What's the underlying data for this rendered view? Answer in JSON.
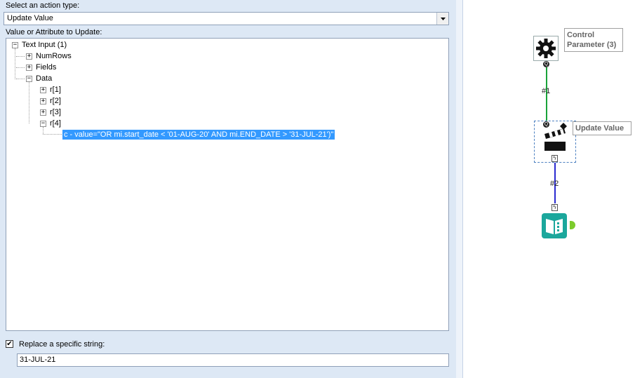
{
  "config": {
    "action_type_label": "Select an action type:",
    "action_type_value": "Update Value",
    "value_attr_label": "Value or Attribute to Update:",
    "tree": {
      "root": "Text Input (1)",
      "numrows": "NumRows",
      "fields": "Fields",
      "data": "Data",
      "r1": "r[1]",
      "r2": "r[2]",
      "r3": "r[3]",
      "r4": "r[4]",
      "selected_value": "c - value=\"OR mi.start_date < '01-AUG-20' AND mi.END_DATE > '31-JUL-21')\""
    },
    "replace_checked": true,
    "replace_label": "Replace a specific string:",
    "replace_value": "31-JUL-21"
  },
  "canvas": {
    "control_param_label": "Control Parameter (3)",
    "update_value_label": "Update Value",
    "conn1_label": "#1",
    "conn2_label": "#2",
    "icons": [
      "gear-icon",
      "clapperboard-icon",
      "browse-book-icon"
    ],
    "colors": {
      "gear_bg": "#ffffff",
      "conn1": "#1aa33a",
      "conn2": "#2a2ad0",
      "browse": "#1ba79c",
      "output_anchor": "#7ccb2c",
      "selection": "#3399ff"
    }
  }
}
